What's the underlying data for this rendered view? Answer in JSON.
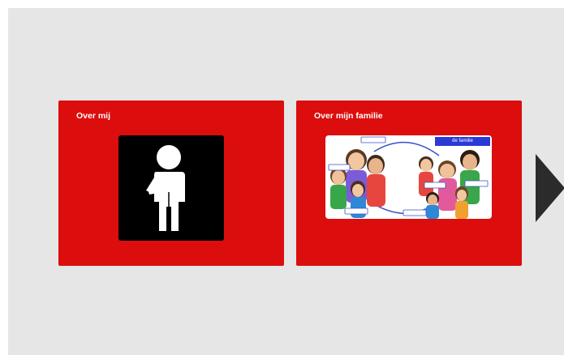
{
  "cards": [
    {
      "title": "Over mij",
      "icon": "person-pointing-self-icon"
    },
    {
      "title": "Over mijn familie",
      "icon": "family-illustration",
      "tag": "de familie"
    }
  ],
  "navigation": {
    "next_icon": "chevron-right-icon"
  },
  "colors": {
    "card_background": "#dc0d0d",
    "stage_background": "#e6e6e6",
    "arrow": "#2b2b2b",
    "tag_background": "#2a3ad6"
  }
}
